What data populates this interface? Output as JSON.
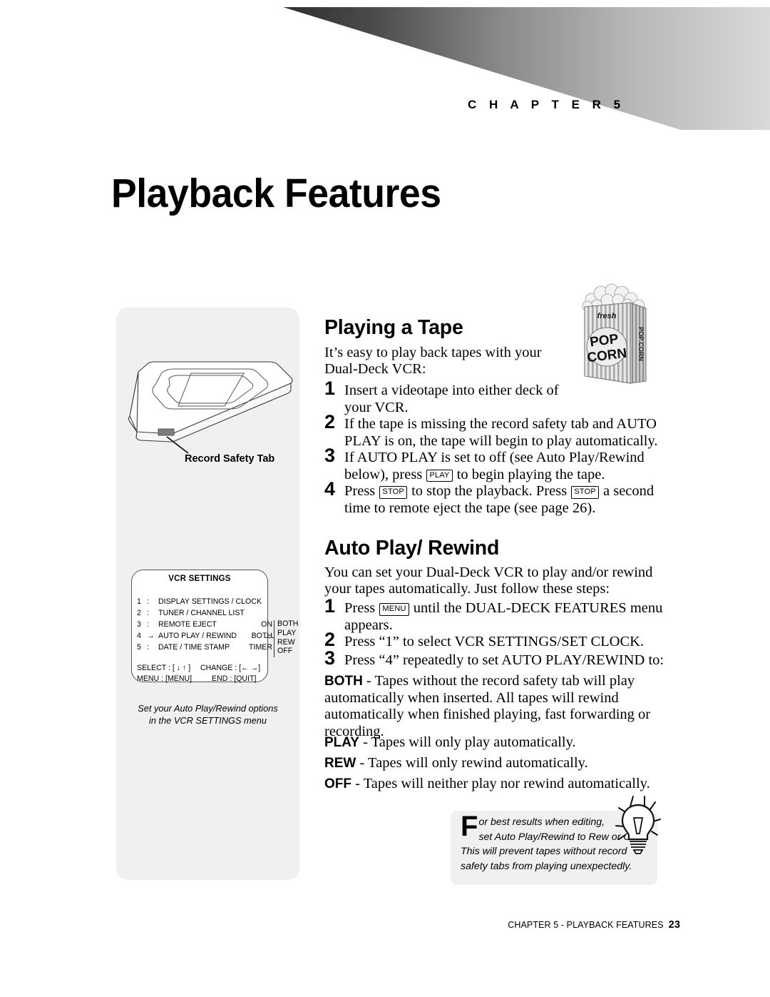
{
  "chapter": {
    "label": "C H A P T E R   5",
    "number": "5"
  },
  "page_title": "Playback Features",
  "sidebar": {
    "tape_figure": {
      "callout_label": "Record Safety Tab"
    },
    "vcr_menu": {
      "title": "VCR SETTINGS",
      "rows": [
        {
          "num": "1",
          "sep": ":",
          "label": "DISPLAY SETTINGS / CLOCK",
          "value": ""
        },
        {
          "num": "2",
          "sep": ":",
          "label": "TUNER / CHANNEL LIST",
          "value": ""
        },
        {
          "num": "3",
          "sep": ":",
          "label": "REMOTE EJECT",
          "value": "ON"
        },
        {
          "num": "4",
          "sep": "→",
          "label": "AUTO PLAY / REWIND",
          "value": "BOTH"
        },
        {
          "num": "5",
          "sep": ":",
          "label": "DATE / TIME STAMP",
          "value": "TIMER"
        }
      ],
      "footer_left_top": "SELECT : [ ↓ ↑ ]",
      "footer_right_top": "CHANGE : [← →]",
      "footer_left_bottom": "MENU : [MENU]",
      "footer_right_bottom": "END : [QUIT]",
      "options": [
        "BOTH",
        "PLAY",
        "REW",
        "OFF"
      ]
    },
    "caption_line1": "Set your Auto Play/Rewind options",
    "caption_line2": "in the VCR SETTINGS menu"
  },
  "playing_a_tape": {
    "heading": "Playing a Tape",
    "intro": "It’s easy to play back tapes with your Dual-Deck VCR:",
    "steps": [
      {
        "num": "1",
        "text_before": "Insert a videotape into either deck of your VCR.",
        "key1": "",
        "text_mid": "",
        "key2": "",
        "text_after": ""
      },
      {
        "num": "2",
        "text_before": "If the tape is missing the record safety tab and AUTO PLAY is on, the tape will begin to play automatically.",
        "key1": "",
        "text_mid": "",
        "key2": "",
        "text_after": ""
      },
      {
        "num": "3",
        "text_before": "If AUTO PLAY is set to off (see Auto Play/Rewind below), press ",
        "key1": "PLAY",
        "text_mid": " to begin playing the tape.",
        "key2": "",
        "text_after": ""
      },
      {
        "num": "4",
        "text_before": "Press ",
        "key1": "STOP",
        "text_mid": " to stop the playback. Press ",
        "key2": "STOP",
        "text_after": " a second time to remote eject the tape (see page 26)."
      }
    ]
  },
  "auto_play_rewind": {
    "heading": "Auto Play/ Rewind",
    "intro": "You can set your Dual-Deck VCR to play and/or rewind your tapes automatically. Just follow these steps:",
    "steps": [
      {
        "num": "1",
        "text_before": "Press ",
        "key1": "MENU",
        "text_mid": " until the DUAL-DECK FEATURES menu appears.",
        "key2": "",
        "text_after": ""
      },
      {
        "num": "2",
        "text_before": "Press “1” to select VCR SETTINGS/SET CLOCK.",
        "key1": "",
        "text_mid": "",
        "key2": "",
        "text_after": ""
      },
      {
        "num": "3",
        "text_before": "Press “4” repeatedly to set AUTO PLAY/REWIND to:",
        "key1": "",
        "text_mid": "",
        "key2": "",
        "text_after": ""
      }
    ],
    "definitions": [
      {
        "term": "BOTH",
        "dash": " - ",
        "text": "Tapes without the record safety tab will play automatically when inserted. All tapes will rewind automatically when finished playing, fast forwarding or recording."
      },
      {
        "term": "PLAY",
        "dash": " - ",
        "text": "Tapes will only play automatically."
      },
      {
        "term": "REW",
        "dash": " - ",
        "text": "Tapes will only rewind automatically."
      },
      {
        "term": "OFF",
        "dash": " - ",
        "text": "Tapes will neither play nor rewind automatically."
      }
    ]
  },
  "tip": {
    "dropcap": "F",
    "line1": "or best results when editing,",
    "line2": "set Auto Play/Rewind to Rew or Off.",
    "line3": "This will prevent tapes without record",
    "line4": "safety tabs from playing unexpectedly."
  },
  "footer": {
    "text": "CHAPTER 5 - PLAYBACK FEATURES",
    "page_number": "23"
  },
  "colors": {
    "panel_bg": "#f0f0f0",
    "banner_dark": "#3a3a3a",
    "banner_light": "#d8d8d8",
    "text": "#000000"
  }
}
